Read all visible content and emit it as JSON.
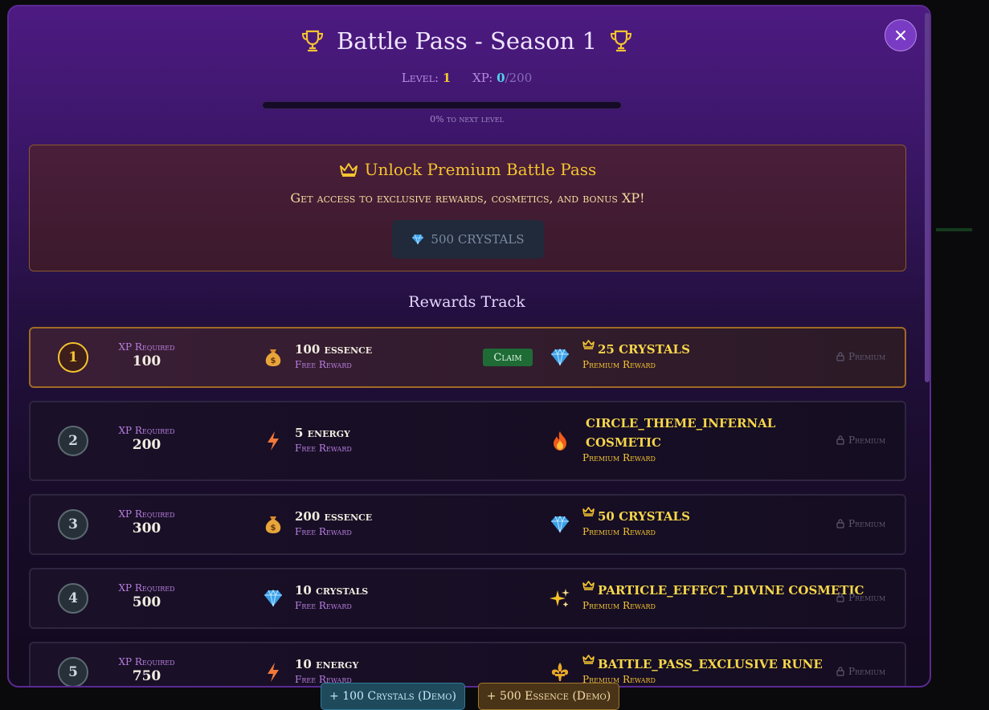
{
  "modal": {
    "title": "Battle Pass - Season 1",
    "level_label": "Level:",
    "level_value": "1",
    "xp_label": "XP:",
    "xp_current": "0",
    "xp_max": "/200",
    "progress_fraction": 0,
    "progress_text": "0% to next level",
    "close_icon": "close-icon"
  },
  "premium": {
    "title": "Unlock Premium Battle Pass",
    "description": "Get access to exclusive rewards, cosmetics, and bonus XP!",
    "button_label": "500 CRYSTALS"
  },
  "track": {
    "heading": "Rewards Track",
    "xp_required_label": "XP Required",
    "premium_lock_label": "Premium",
    "claim_label": "Claim",
    "rows": [
      {
        "level": "1",
        "xp": "100",
        "free_name": "100 essence",
        "free_sub": "Free Reward",
        "free_icon": "money-bag-icon",
        "prem_name": "25 CRYSTALS",
        "prem_sub": "Premium Reward",
        "prem_icon": "gem-icon"
      },
      {
        "level": "2",
        "xp": "200",
        "free_name": "5 energy",
        "free_sub": "Free Reward",
        "free_icon": "lightning-icon",
        "prem_name": "CIRCLE_THEME_INFERNAL COSMETIC",
        "prem_sub": "Premium Reward",
        "prem_icon": "fire-icon"
      },
      {
        "level": "3",
        "xp": "300",
        "free_name": "200 essence",
        "free_sub": "Free Reward",
        "free_icon": "money-bag-icon",
        "prem_name": "50 CRYSTALS",
        "prem_sub": "Premium Reward",
        "prem_icon": "gem-icon"
      },
      {
        "level": "4",
        "xp": "500",
        "free_name": "10 crystals",
        "free_sub": "Free Reward",
        "free_icon": "gem-icon",
        "prem_name": "PARTICLE_EFFECT_DIVINE COSMETIC",
        "prem_sub": "Premium Reward",
        "prem_icon": "sparkles-icon"
      },
      {
        "level": "5",
        "xp": "750",
        "free_name": "10 energy",
        "free_sub": "Free Reward",
        "free_icon": "lightning-icon",
        "prem_name": "BATTLE_PASS_EXCLUSIVE RUNE",
        "prem_sub": "Premium Reward",
        "prem_icon": "fleur-de-lis-icon"
      }
    ]
  },
  "demo": {
    "crystals_label": "+ 100 Crystals (Demo)",
    "essence_label": "+ 500 Essence (Demo)"
  },
  "colors": {
    "accent_gold": "#f4c430",
    "xp_cyan": "#4fd1e8",
    "claim_green": "#1f6b36",
    "modal_purple": "#4d1a82"
  }
}
